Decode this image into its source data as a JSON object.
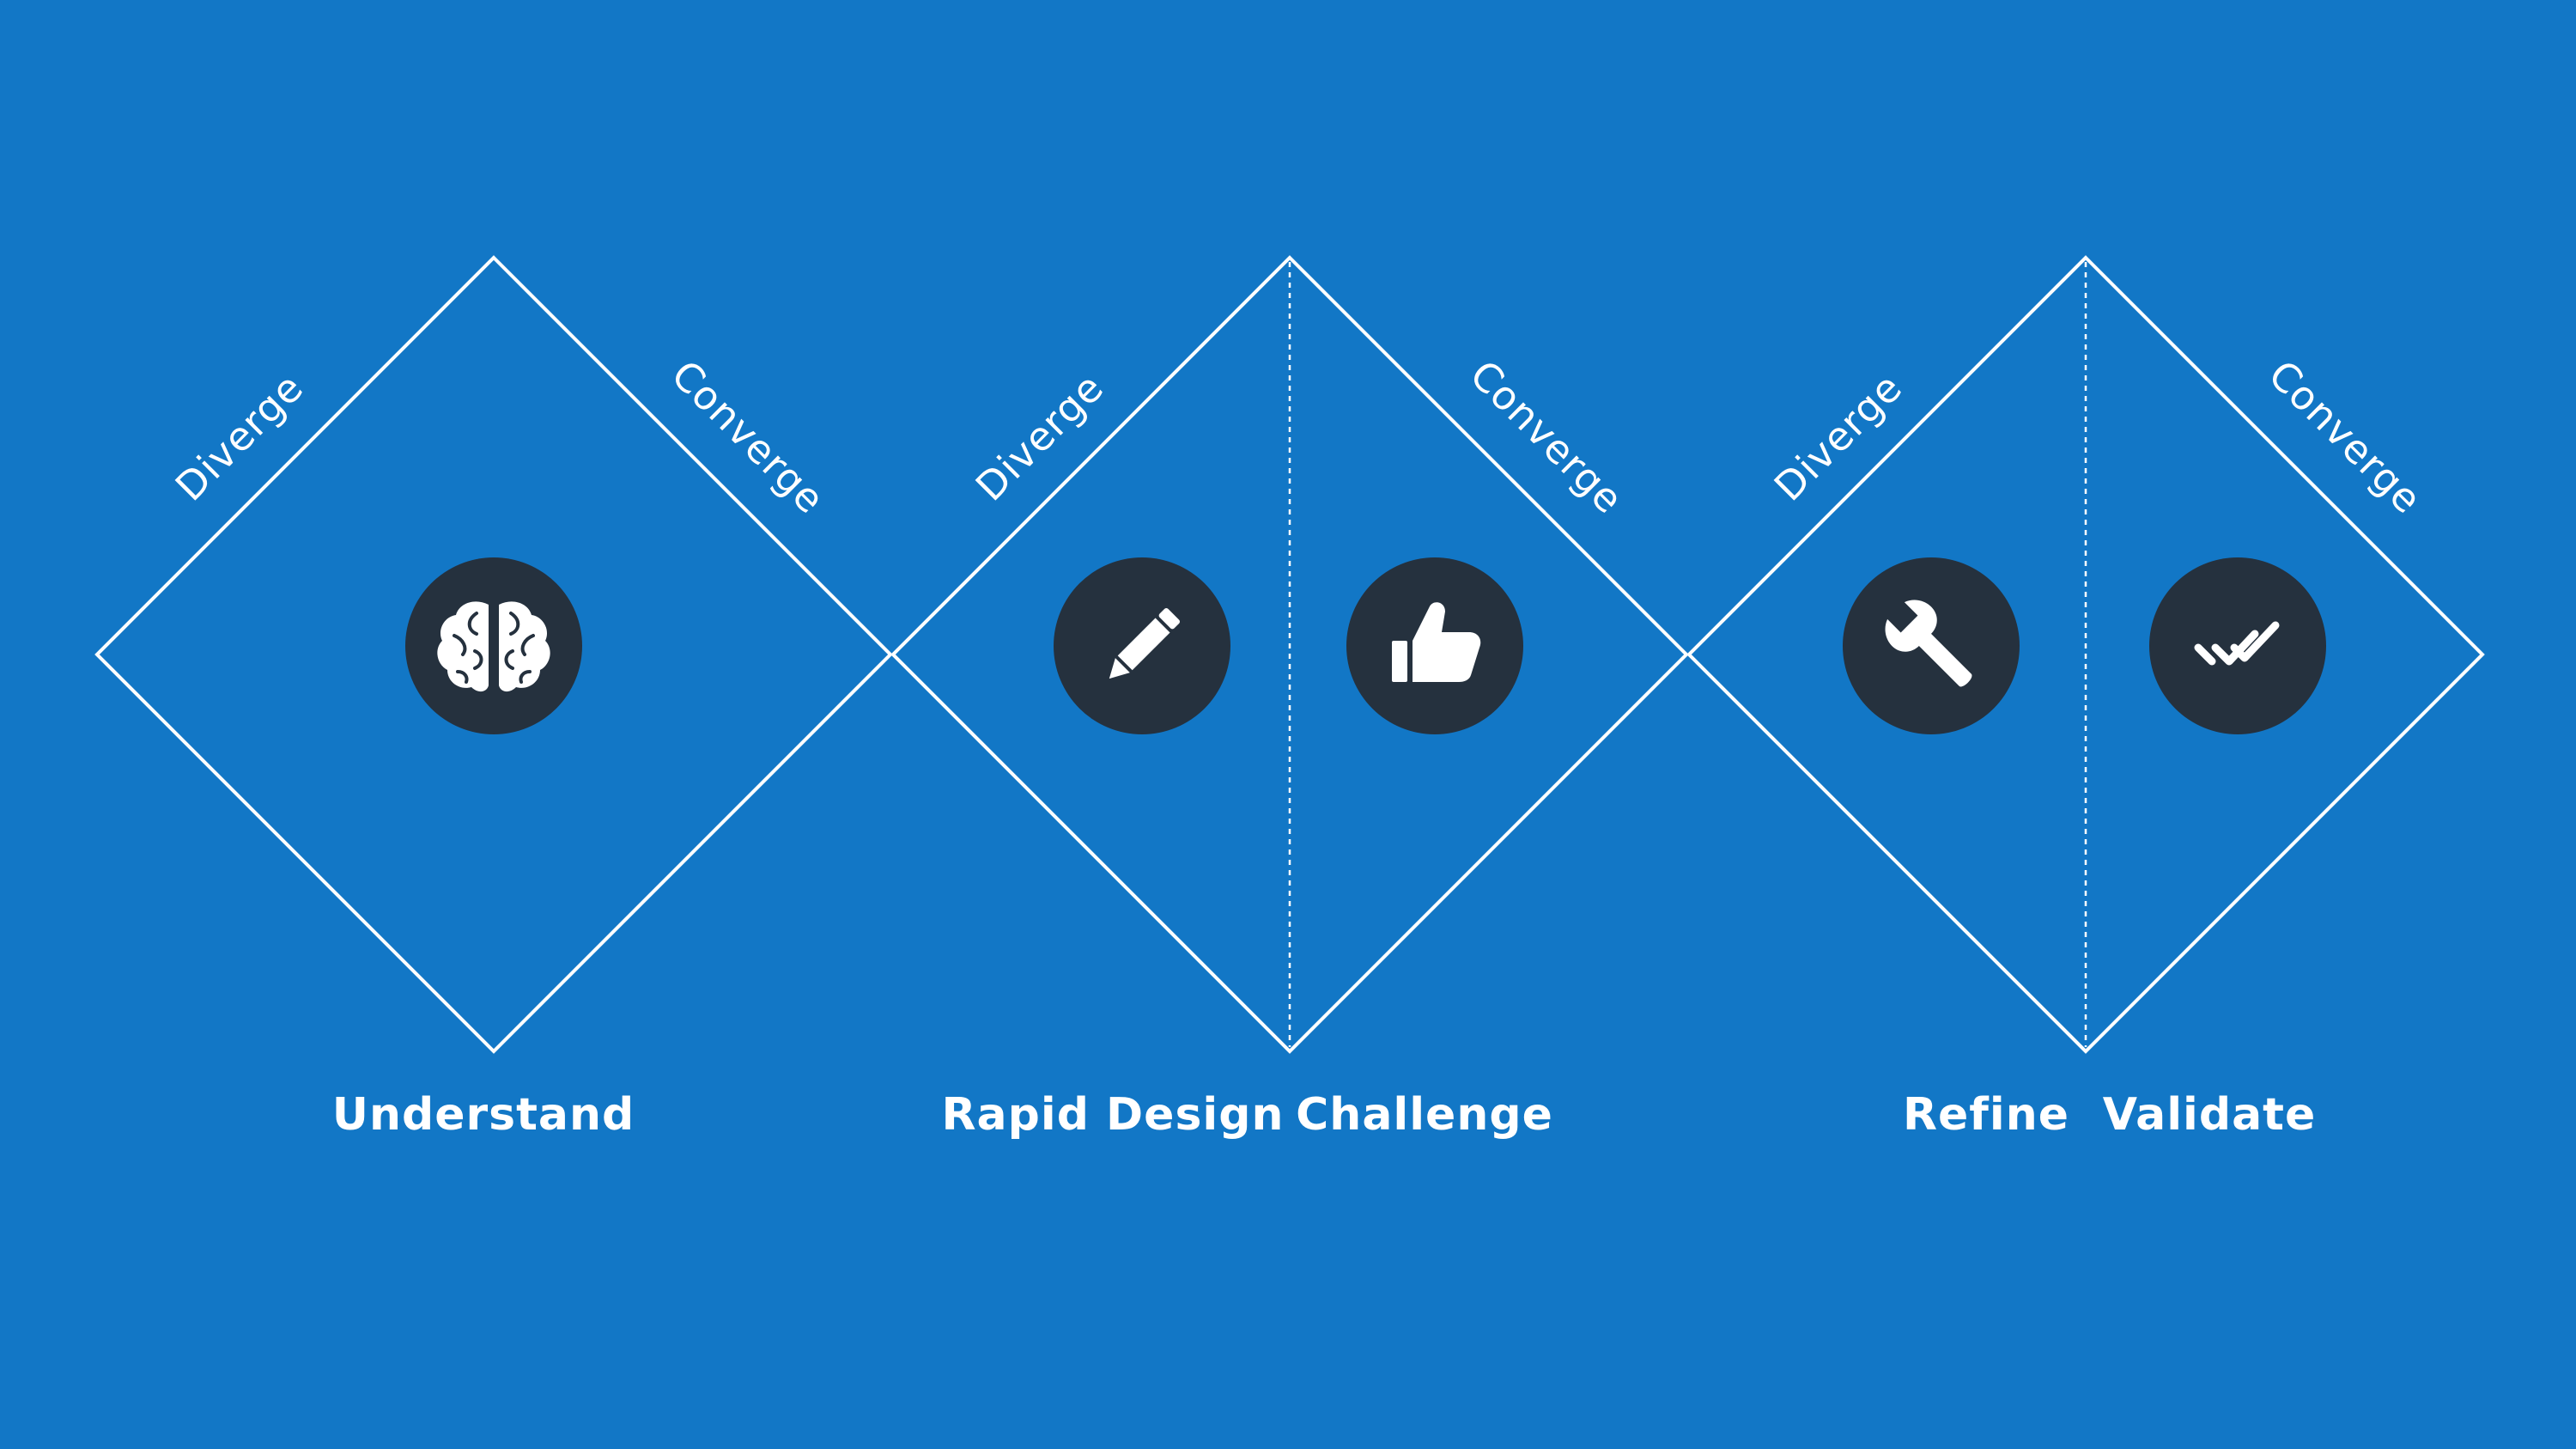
{
  "colors": {
    "background": "#1277c6",
    "lines": "#ffffff",
    "icon_circle": "#25313e",
    "icon_glyph": "#ffffff"
  },
  "diamonds": [
    {
      "diverge_label": "Diverge",
      "converge_label": "Converge"
    },
    {
      "diverge_label": "Diverge",
      "converge_label": "Converge"
    },
    {
      "diverge_label": "Diverge",
      "converge_label": "Converge"
    }
  ],
  "phases": [
    {
      "label": "Understand",
      "icon": "brain-icon"
    },
    {
      "label": "Rapid Design",
      "icon": "pencil-icon"
    },
    {
      "label": "Challenge",
      "icon": "thumbs-up-icon"
    },
    {
      "label": "Refine",
      "icon": "wrench-icon"
    },
    {
      "label": "Validate",
      "icon": "double-check-icon"
    }
  ]
}
